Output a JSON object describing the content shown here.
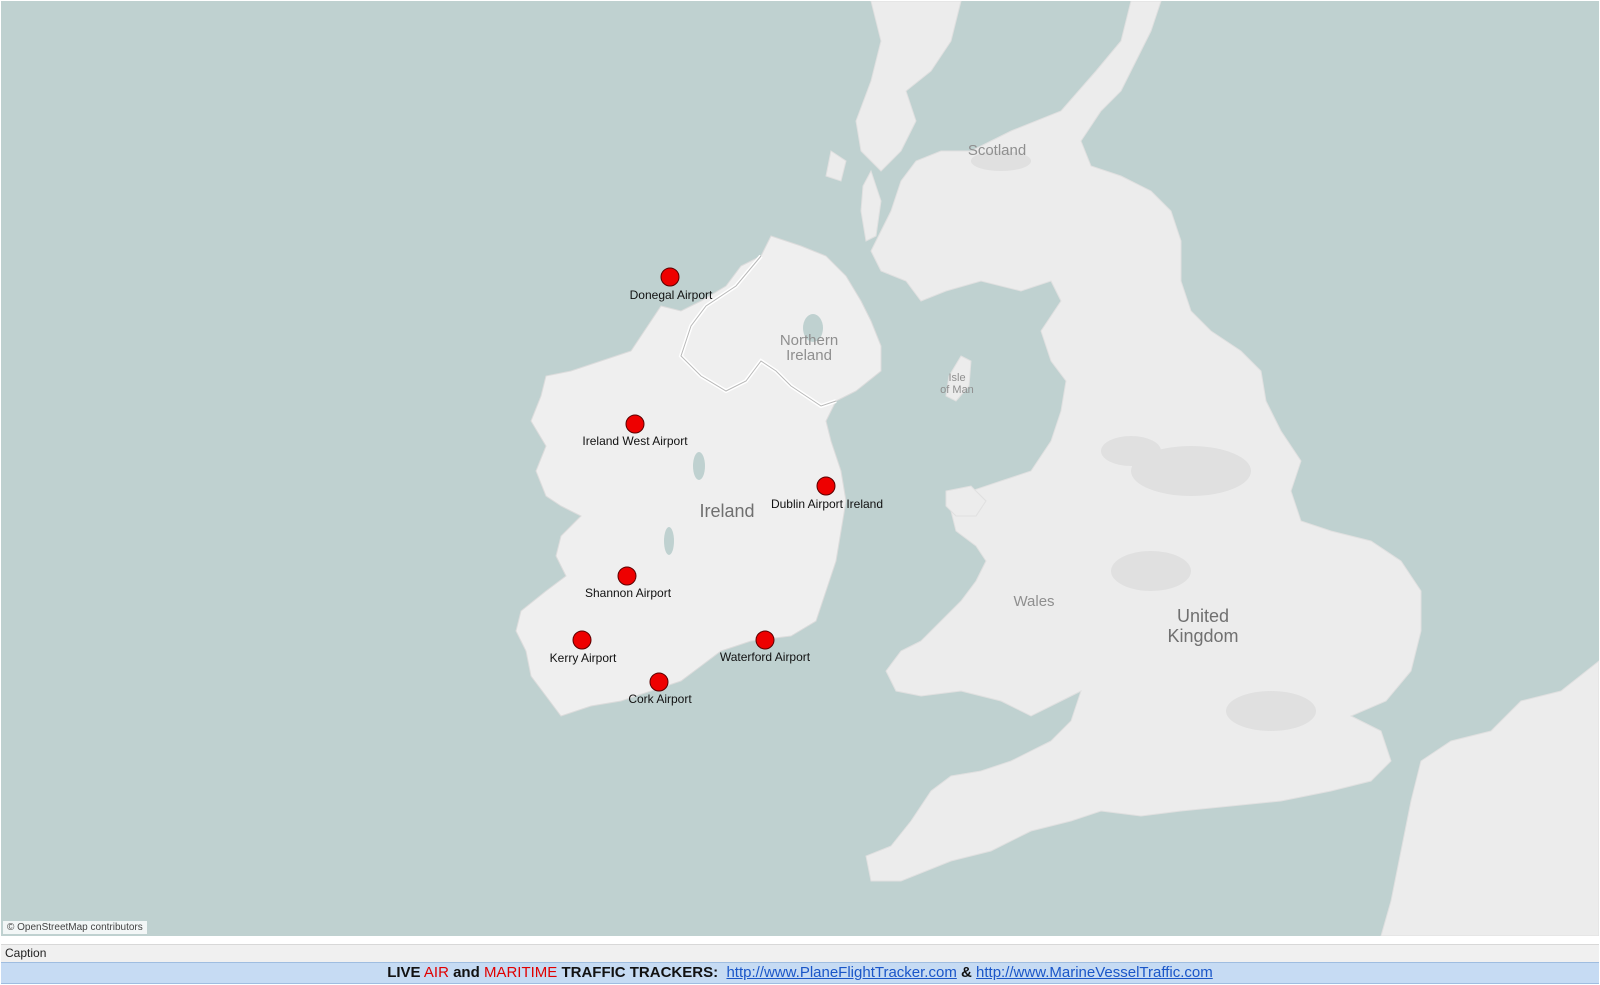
{
  "map": {
    "attribution": "© OpenStreetMap contributors",
    "colors": {
      "water": "#bfd1d0",
      "land": "#ececec",
      "airport_marker": "#ee0000"
    },
    "regions": {
      "scotland": "Scotland",
      "northern_ireland_line1": "Northern",
      "northern_ireland_line2": "Ireland",
      "isle_of_man_line1": "Isle",
      "isle_of_man_line2": "of Man",
      "ireland": "Ireland",
      "wales": "Wales",
      "uk_line1": "United",
      "uk_line2": "Kingdom"
    },
    "airports": [
      {
        "id": "donegal",
        "name": "Donegal Airport",
        "marker_icon": "red-circle-marker"
      },
      {
        "id": "ireland-west",
        "name": "Ireland West Airport",
        "marker_icon": "red-circle-marker"
      },
      {
        "id": "dublin",
        "name": "Dublin Airport Ireland",
        "marker_icon": "red-circle-marker"
      },
      {
        "id": "shannon",
        "name": "Shannon Airport",
        "marker_icon": "red-circle-marker"
      },
      {
        "id": "kerry",
        "name": "Kerry Airport",
        "marker_icon": "red-circle-marker"
      },
      {
        "id": "waterford",
        "name": "Waterford Airport",
        "marker_icon": "red-circle-marker"
      },
      {
        "id": "cork",
        "name": "Cork Airport",
        "marker_icon": "red-circle-marker"
      }
    ]
  },
  "caption": {
    "label": "Caption"
  },
  "banner": {
    "live": "LIVE",
    "air": "AIR",
    "and": "and",
    "maritime": "MARITIME",
    "traffic_trackers": "TRAFFIC TRACKERS:",
    "link1": "http://www.PlaneFlightTracker.com",
    "amp": "&",
    "link2": "http://www.MarineVesselTraffic.com"
  }
}
